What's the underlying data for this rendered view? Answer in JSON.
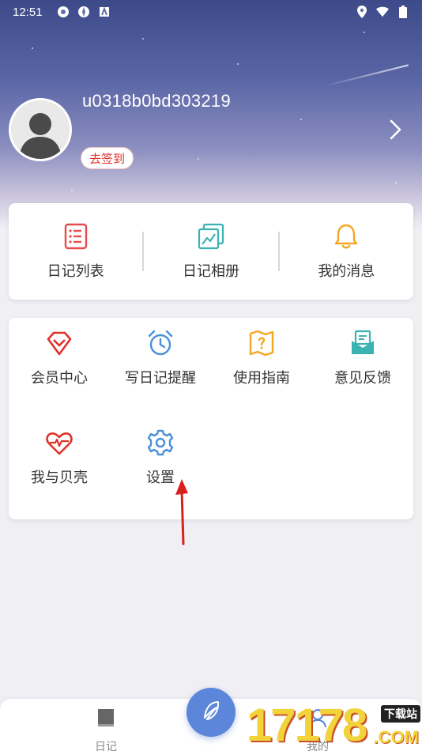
{
  "status_bar": {
    "time": "12:51"
  },
  "profile": {
    "username": "u0318b0bd303219",
    "signin_label": "去签到"
  },
  "quick_actions": [
    {
      "label": "日记列表",
      "icon": "list-icon"
    },
    {
      "label": "日记相册",
      "icon": "album-icon"
    },
    {
      "label": "我的消息",
      "icon": "bell-icon"
    }
  ],
  "features": [
    {
      "label": "会员中心",
      "icon": "diamond-icon"
    },
    {
      "label": "写日记提醒",
      "icon": "alarm-clock-icon"
    },
    {
      "label": "使用指南",
      "icon": "guide-map-icon"
    },
    {
      "label": "意见反馈",
      "icon": "feedback-mail-icon"
    },
    {
      "label": "我与贝壳",
      "icon": "heart-pulse-icon"
    },
    {
      "label": "设置",
      "icon": "gear-icon"
    }
  ],
  "tab_bar": {
    "diary_label": "日记",
    "mine_label": "我的"
  },
  "watermark": {
    "number": "17178",
    "tag": "下载站",
    "domain": ".COM"
  },
  "colors": {
    "accent_red": "#e0312b",
    "accent_blue": "#4a90d9",
    "accent_orange": "#f5a623",
    "accent_teal": "#3bb3b3",
    "fab_blue": "#5b86d9"
  }
}
